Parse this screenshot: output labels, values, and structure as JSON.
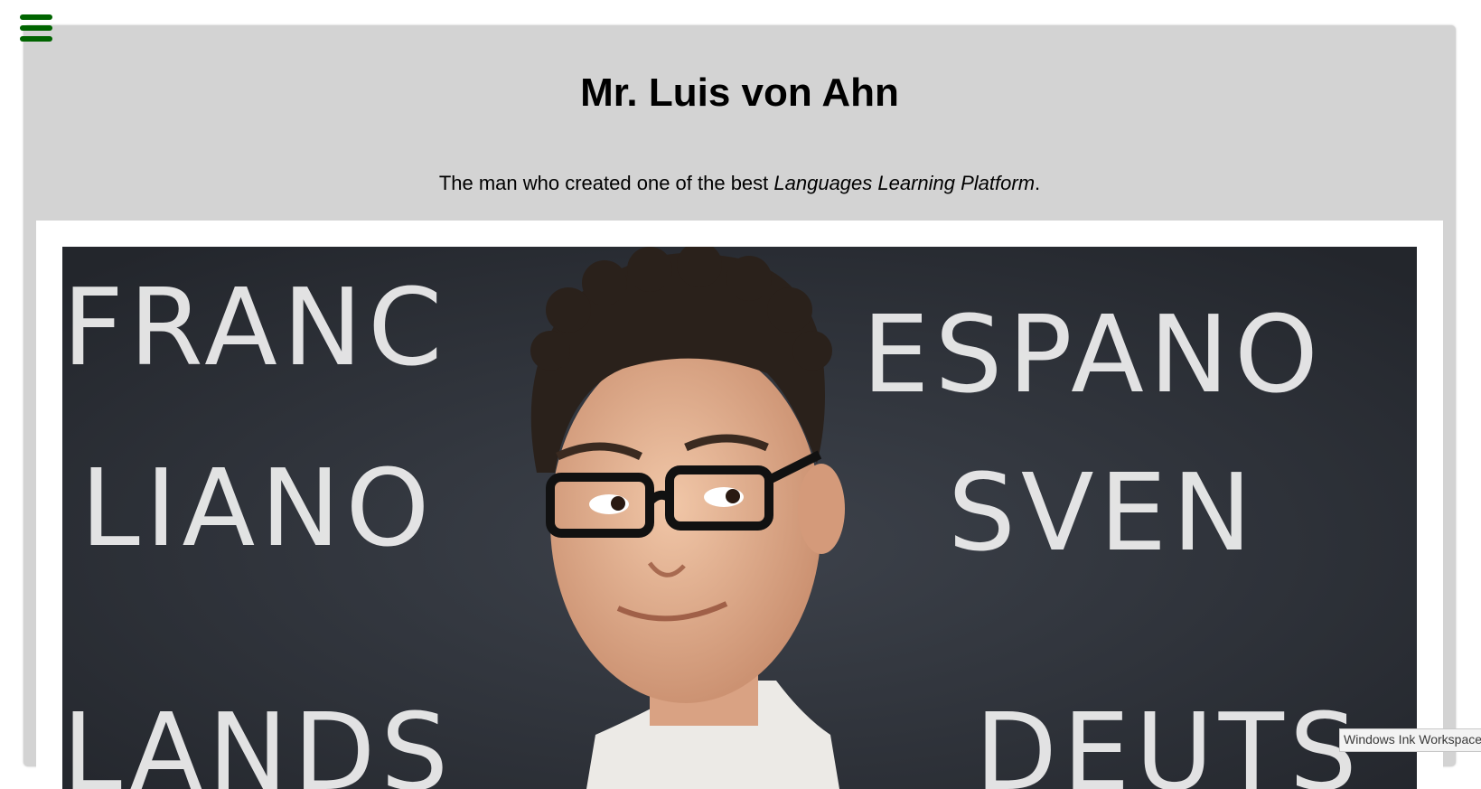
{
  "menu": {
    "icon": "hamburger-menu-icon"
  },
  "header": {
    "title": "Mr. Luis von Ahn",
    "subtitle_before": "The man who created one of the best ",
    "subtitle_emphasis": "Languages Learning Platform",
    "subtitle_after": "."
  },
  "photo": {
    "chalk_words": [
      "FRANC",
      "ESPANO",
      "LIANO",
      "SVEN",
      "LANDS",
      "DEUTS"
    ]
  },
  "taskbar": {
    "ink_workspace_label": "Windows Ink Workspace"
  },
  "colors": {
    "menu_icon": "#006400",
    "panel_background": "#d3d3d3",
    "chalkboard": "#2b2f36"
  }
}
